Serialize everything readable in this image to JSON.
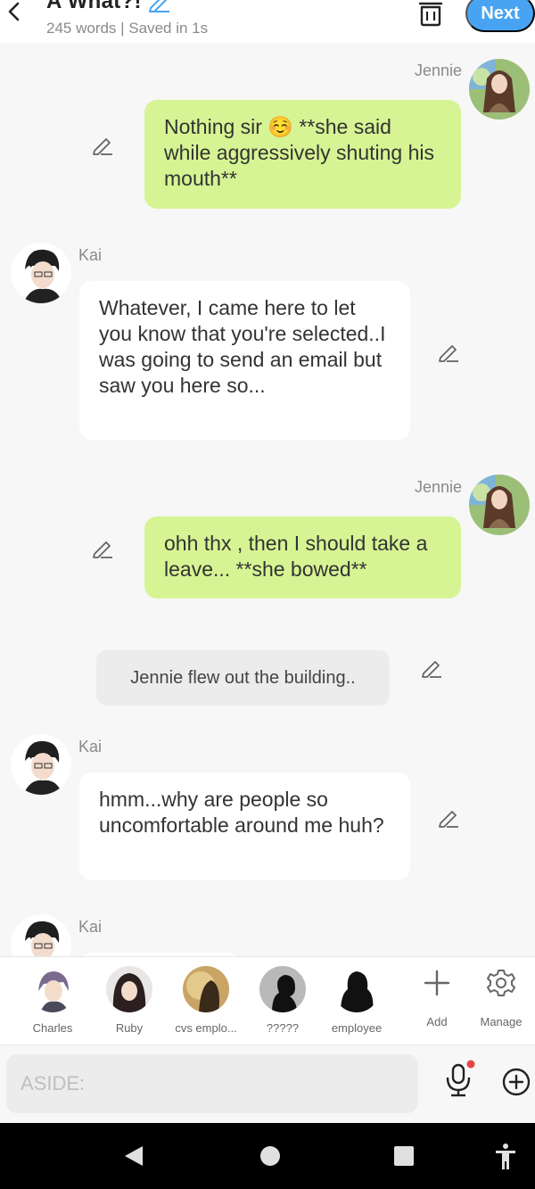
{
  "header": {
    "title": "A What?!",
    "subtitle": "245 words | Saved in 1s",
    "next_label": "Next"
  },
  "messages": [
    {
      "type": "me",
      "name": "Jennie",
      "text": "Nothing sir ☺️ **she said while aggressively shuting his mouth**"
    },
    {
      "type": "other",
      "name": "Kai",
      "text": "Whatever, I came here to let you know that you're selected..I was going to send an email but saw you here so..."
    },
    {
      "type": "me",
      "name": "Jennie",
      "text": "ohh thx , then I should take a leave... **she bowed**"
    },
    {
      "type": "narration",
      "text": "Jennie flew out the building.."
    },
    {
      "type": "other",
      "name": "Kai",
      "text": "hmm...why are people so uncomfortable around me huh?"
    },
    {
      "type": "other",
      "name": "Kai",
      "text": ""
    }
  ],
  "characters": [
    {
      "name": "Charles"
    },
    {
      "name": "Ruby"
    },
    {
      "name": "cvs emplo..."
    },
    {
      "name": "?????"
    },
    {
      "name": "employee"
    }
  ],
  "tools": {
    "add_label": "Add",
    "manage_label": "Manage"
  },
  "input": {
    "placeholder": "ASIDE:"
  },
  "icons": {
    "back": "chevron-left-icon",
    "title_edit": "pencil-icon",
    "trash": "trash-icon",
    "message_edit": "pencil-icon",
    "add": "plus-icon",
    "manage": "gear-icon",
    "mic": "microphone-icon",
    "more": "plus-circle-icon",
    "nav_back": "triangle-back-icon",
    "nav_home": "circle-home-icon",
    "nav_recents": "square-recents-icon",
    "accessibility": "accessibility-icon"
  },
  "colors": {
    "accent": "#48a4f2",
    "my_bubble": "#d6f493",
    "other_bubble": "#ffffff",
    "narration_bg": "#ececec",
    "background": "#f7f7f7",
    "mic_dot": "#e84545"
  }
}
